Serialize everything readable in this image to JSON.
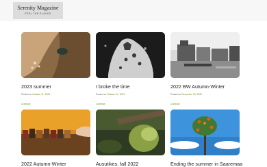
{
  "site": {
    "title": "Serenity Magazine",
    "tagline": "FEEL THE PLACES"
  },
  "posts": [
    {
      "title": "2023 summer",
      "posted_label": "Posted on",
      "date": "October 11, 2023",
      "continue_label": "Continue"
    },
    {
      "title": "I broke the time",
      "posted_label": "Posted on",
      "date": "October 11, 2023",
      "continue_label": "Continue"
    },
    {
      "title": "2022 BW Autumn-Winter",
      "posted_label": "Posted on",
      "date": "December 30, 2022",
      "continue_label": "Continue"
    },
    {
      "title": "2022 Autumn-Winter",
      "posted_label": "",
      "date": "",
      "continue_label": ""
    },
    {
      "title": "Ausutikes, fall 2022",
      "posted_label": "",
      "date": "",
      "continue_label": ""
    },
    {
      "title": "Ending the summer in Saaremaa",
      "posted_label": "",
      "date": "",
      "continue_label": ""
    }
  ],
  "colors": {
    "header_bg": "#f7f7f7",
    "logo_bg": "#dcdcdc",
    "accent": "#6a8a2a"
  }
}
